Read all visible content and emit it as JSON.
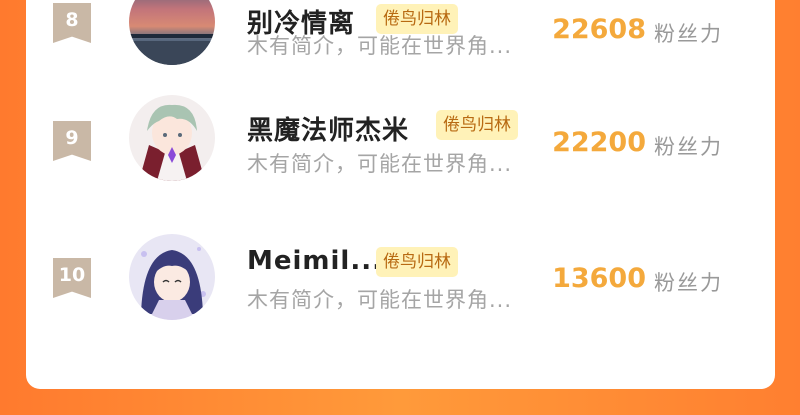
{
  "rows": [
    {
      "rank": "8",
      "name": "别冷情离",
      "tag": "倦鸟归林",
      "intro": "木有简介，可能在世界角...",
      "fans": "22608",
      "fans_unit": "粉丝力",
      "avatar": "sunset-sea-avatar"
    },
    {
      "rank": "9",
      "name": "黑魔法师杰米",
      "tag": "倦鸟归林",
      "intro": "木有简介，可能在世界角...",
      "fans": "22200",
      "fans_unit": "粉丝力",
      "avatar": "anime-mage-avatar"
    },
    {
      "rank": "10",
      "name": "Meimil...",
      "tag": "倦鸟归林",
      "intro": "木有简介，可能在世界角...",
      "fans": "13600",
      "fans_unit": "粉丝力",
      "avatar": "anime-girl-avatar"
    }
  ],
  "colors": {
    "background": "#ff8a33",
    "card": "#ffffff",
    "rank_badge": "#c9b8a6",
    "tag_bg": "#fff2b8",
    "tag_text": "#b86a12",
    "fans_number": "#f4a93c"
  }
}
